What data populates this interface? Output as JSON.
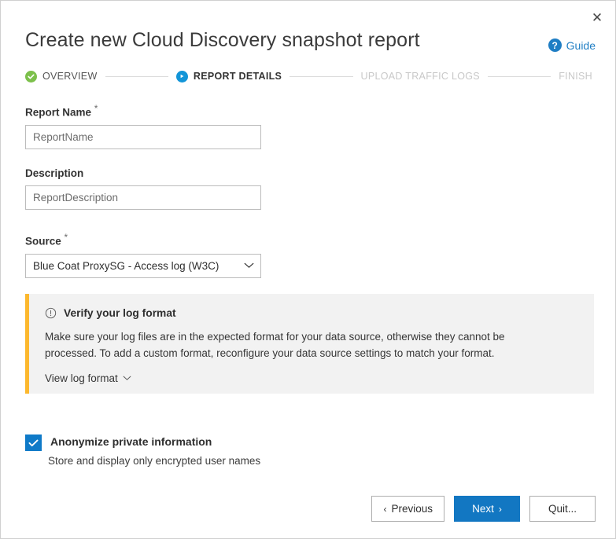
{
  "window": {
    "title": "Create new Cloud Discovery snapshot report",
    "close_label": "✕",
    "close_icon": "close-icon"
  },
  "guide": {
    "label": "Guide",
    "icon": "question-mark-circle-icon",
    "color": "#1f7ec4"
  },
  "stepper": {
    "steps": [
      {
        "label": "OVERVIEW",
        "state": "done",
        "icon": "check-circle-icon",
        "color": "#7cc04b"
      },
      {
        "label": "REPORT DETAILS",
        "state": "active",
        "icon": "play-circle-icon",
        "color": "#1295d8"
      },
      {
        "label": "UPLOAD TRAFFIC LOGS",
        "state": "future",
        "icon": "none",
        "color": "#c8c8c8"
      },
      {
        "label": "FINISH",
        "state": "future",
        "icon": "none",
        "color": "#c8c8c8"
      }
    ]
  },
  "form": {
    "report_name": {
      "label": "Report Name",
      "required_marker": "*",
      "value": "",
      "placeholder": "ReportName"
    },
    "description": {
      "label": "Description",
      "required_marker": "",
      "value": "",
      "placeholder": "ReportDescription"
    },
    "source": {
      "label": "Source",
      "required_marker": "*",
      "selected": "Blue Coat ProxySG - Access log (W3C)",
      "chevron_icon": "chevron-down-icon"
    }
  },
  "infobox": {
    "icon": "info-exclamation-circle-icon",
    "title": "Verify your log format",
    "body": "Make sure your log files are in the expected format for your data source, otherwise they cannot be processed. To add a custom format, reconfigure your data source settings to match your format.",
    "link_label": "View log format",
    "link_chevron_icon": "chevron-down-icon",
    "accent_color": "#fcb82e",
    "background_color": "#f2f2f2"
  },
  "anonymize": {
    "checked": true,
    "label": "Anonymize private information",
    "sublabel": "Store and display only encrypted user names",
    "checkbox_color": "#0f7ac8",
    "check_icon": "checkmark-icon"
  },
  "footer": {
    "previous": {
      "label": "Previous",
      "chevron": "‹",
      "icon": "chevron-left-icon"
    },
    "next": {
      "label": "Next",
      "chevron": "›",
      "icon": "chevron-right-icon",
      "color": "#1277c2"
    },
    "quit": {
      "label": "Quit..."
    }
  }
}
